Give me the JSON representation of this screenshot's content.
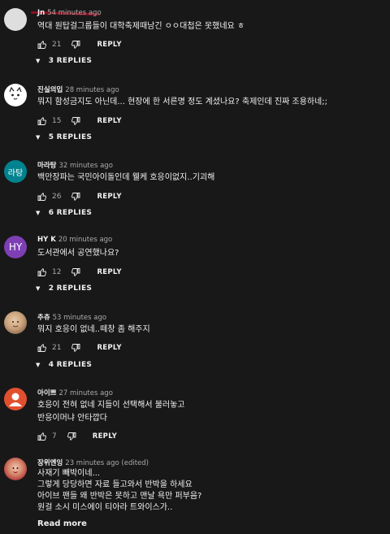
{
  "comments": [
    {
      "author": "Jn",
      "time": "54 minutes ago",
      "lines": [
        "역대 원탑걸그룹들이 대학축제때남긴 ㅇㅇ대첩은 못했네요 ㅎ"
      ],
      "likes": "21",
      "reply_label": "REPLY",
      "replies": "3 REPLIES",
      "avatar": {
        "kind": "plain",
        "bg": "#dedede",
        "text": ""
      }
    },
    {
      "author": "진실의입",
      "time": "28 minutes ago",
      "lines": [
        "뭐지 함성금지도 아닌데... 현장에 한 서른명 정도 계셨나요? 축제인데 진짜 조용하네;;"
      ],
      "likes": "15",
      "reply_label": "REPLY",
      "replies": "5 REPLIES",
      "avatar": {
        "kind": "face",
        "bg": "#ffffff",
        "text": ""
      }
    },
    {
      "author": "마라탕",
      "time": "32 minutes ago",
      "lines": [
        "백만장파는 국민아이돌인데 웰케 호응이없지..기괴해"
      ],
      "likes": "26",
      "reply_label": "REPLY",
      "replies": "6 REPLIES",
      "avatar": {
        "kind": "text",
        "bg": "#00838f",
        "text": "라탕"
      }
    },
    {
      "author": "HY K",
      "time": "20 minutes ago",
      "lines": [
        "도서관에서 공연했나요?"
      ],
      "likes": "12",
      "reply_label": "REPLY",
      "replies": "2 REPLIES",
      "avatar": {
        "kind": "text",
        "bg": "#7e3fb5",
        "text": "HY"
      }
    },
    {
      "author": "추츄",
      "time": "53 minutes ago",
      "lines": [
        "뭐지 호응이 없네..떼창 좀 해주지"
      ],
      "likes": "21",
      "reply_label": "REPLY",
      "replies": "4 REPLIES",
      "avatar": {
        "kind": "photo",
        "bg": "#c9a27c",
        "text": ""
      }
    },
    {
      "author": "아이쁘",
      "time": "27 minutes ago",
      "lines": [
        "호응이 전혀 없네 지들이 선택해서 불러놓고",
        "반응이머냐 안타깝다"
      ],
      "likes": "7",
      "reply_label": "REPLY",
      "replies": "",
      "avatar": {
        "kind": "person",
        "bg": "#e0502f",
        "text": ""
      }
    },
    {
      "author": "장위엔잉",
      "time": "23 minutes ago (edited)",
      "lines": [
        "사재기 빼박이네...",
        "그렇게 당당하면 자료 들고와서 반박을 하세요",
        "아이브 팬들 왜 반박은 못하고 맨날 욕만 퍼부음?",
        "원걸 소시 미스에이 티아라 트와이스가.."
      ],
      "likes": "",
      "reply_label": "",
      "replies": "",
      "read_more": "Read more",
      "avatar": {
        "kind": "photo2",
        "bg": "#b53a3a",
        "text": ""
      }
    }
  ],
  "icons": {
    "like": "thumbs-up-icon",
    "dislike": "thumbs-down-icon",
    "expand": "caret-down-icon"
  }
}
